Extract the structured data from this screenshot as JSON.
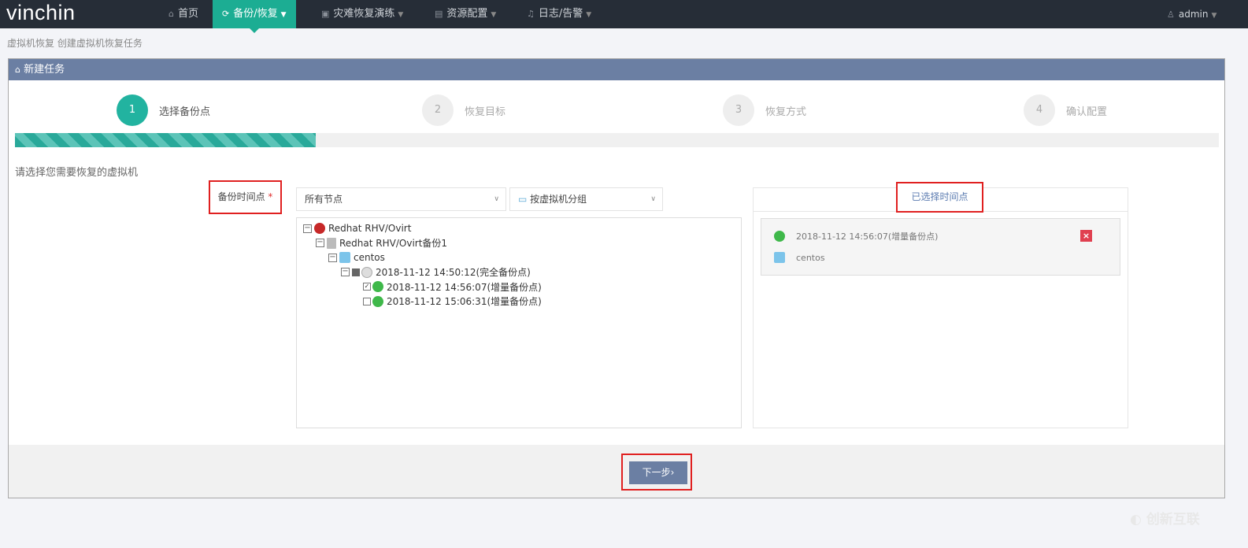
{
  "nav": {
    "logo": "vinchin",
    "items": [
      {
        "label": "首页",
        "icon": "home-icon"
      },
      {
        "label": "备份/恢复",
        "icon": "refresh-icon"
      },
      {
        "label": "灾难恢复演练",
        "icon": "drill-icon"
      },
      {
        "label": "资源配置",
        "icon": "server-icon"
      },
      {
        "label": "日志/告警",
        "icon": "bell-icon"
      }
    ],
    "user": "admin"
  },
  "breadcrumb": {
    "section": "虚拟机恢复",
    "page": "创建虚拟机恢复任务"
  },
  "panel": {
    "title": "新建任务"
  },
  "steps": [
    {
      "num": "1",
      "label": "选择备份点"
    },
    {
      "num": "2",
      "label": "恢复目标"
    },
    {
      "num": "3",
      "label": "恢复方式"
    },
    {
      "num": "4",
      "label": "确认配置"
    }
  ],
  "progress_percent": 25,
  "hint": "请选择您需要恢复的虚拟机",
  "form": {
    "label": "备份时间点",
    "required": "*",
    "node_select": "所有节点",
    "group_select": "按虚拟机分组"
  },
  "tree": [
    "Redhat RHV/Ovirt",
    "Redhat RHV/Ovirt备份1",
    "centos",
    "2018-11-12 14:50:12(完全备份点)",
    "2018-11-12 14:56:07(增量备份点)",
    "2018-11-12 15:06:31(增量备份点)"
  ],
  "selected": {
    "title": "已选择时间点",
    "point": "2018-11-12 14:56:07(增量备份点)",
    "vm": "centos"
  },
  "next_button": "下一步",
  "watermark": "创新互联"
}
